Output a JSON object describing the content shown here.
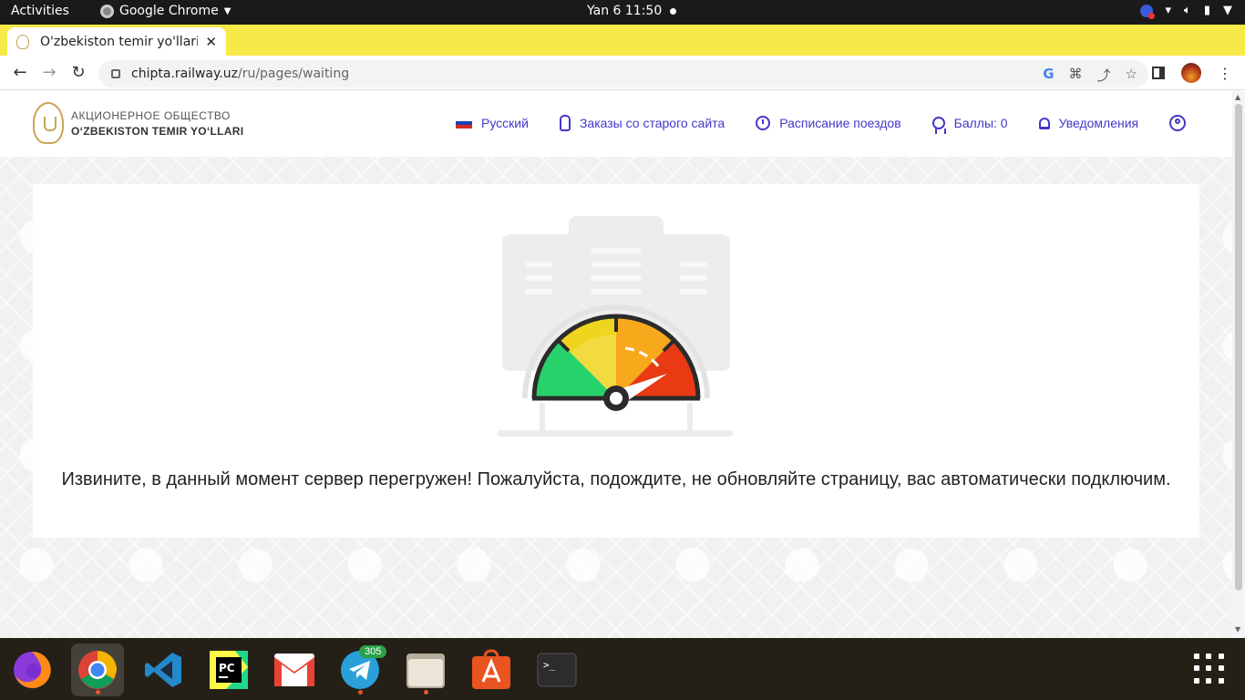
{
  "system_bar": {
    "activities": "Activities",
    "app_name": "Google Chrome",
    "clock": "Yan 6  11:50"
  },
  "browser": {
    "tab_title": "O'zbekiston temir yo'llari",
    "url_host": "chipta.railway.uz",
    "url_path": "/ru/pages/waiting",
    "accent_color": "#f7ea48"
  },
  "site": {
    "logo_line1": "АКЦИОНЕРНОЕ ОБЩЕСТВО",
    "logo_line2": "O‘ZBEKISTON TEMIR YO‘LLARI",
    "nav": {
      "language": "Русский",
      "old_orders": "Заказы со старого сайта",
      "schedule": "Расписание поездов",
      "points": "Баллы: 0",
      "notifications": "Уведомления"
    },
    "nav_color": "#4438c9"
  },
  "main": {
    "message": "Извините, в данный момент сервер перегружен! Пожалуйста, подождите, не обновляйте страницу, вас автоматически подключим."
  },
  "dock": {
    "telegram_badge": "305",
    "apps": [
      "firefox-icon",
      "chrome-icon",
      "vscode-icon",
      "pycharm-icon",
      "gmail-icon",
      "telegram-icon",
      "files-icon",
      "app-store-icon",
      "terminal-icon"
    ]
  }
}
